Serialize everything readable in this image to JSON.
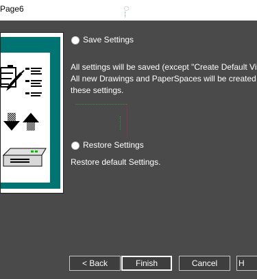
{
  "window": {
    "title": "Page6"
  },
  "options": {
    "save": {
      "label": "Save Settings",
      "description_lines": [
        "All settings will be saved (except \"Create Default View",
        "All new Drawings and PaperSpaces will be created w",
        "these settings."
      ]
    },
    "restore": {
      "label": "Restore Settings",
      "description": "Restore default Settings."
    }
  },
  "buttons": {
    "back": "< Back",
    "finish": "Finish",
    "cancel": "Cancel",
    "help": "H"
  },
  "colors": {
    "background": "#4a4a4a",
    "illustration_frame": "#007373",
    "illustration_card": "#ffffff",
    "titlebar": "#ffffff"
  },
  "illustration": {
    "icons": [
      "clipboard-icon",
      "pencil-icon",
      "arrow-down-icon",
      "arrow-up-icon",
      "printer-icon"
    ]
  }
}
